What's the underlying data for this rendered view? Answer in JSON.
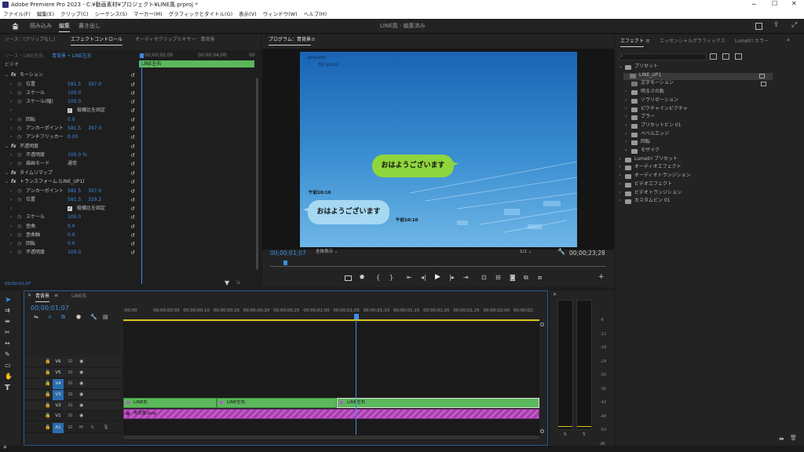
{
  "window": {
    "title": "Adobe Premiere Pro 2023 - C:¥動画素材¥プロジェクト¥LINE風.prproj *"
  },
  "menu": [
    "ファイル(F)",
    "編集(E)",
    "クリップ(C)",
    "シーケンス(S)",
    "マーカー(M)",
    "グラフィックとタイトル(G)",
    "表示(V)",
    "ウィンドウ(W)",
    "ヘルプ(H)"
  ],
  "workspace": {
    "tabs": [
      "読み込み",
      "編集",
      "書き出し"
    ],
    "active": "編集",
    "center": "LINE風 - 編集済み"
  },
  "effect_controls": {
    "tabs": [
      "ソース：(クリップなし)",
      "エフェクトコントロール",
      "オーディオクリップミキサー：青背景"
    ],
    "header_left": "ソース・LINE左右",
    "header_right": "青背景 • LINE左右",
    "ruler": [
      "00;00;02;00",
      "00;00;04;00",
      "00"
    ],
    "clip_label": "LINE左右",
    "video_label": "ビデオ",
    "rows": [
      {
        "name": "モーション",
        "value": "",
        "value2": ""
      },
      {
        "name": "位置",
        "value": "581.5",
        "value2": "397.0"
      },
      {
        "name": "スケール",
        "value": "100.0",
        "value2": ""
      },
      {
        "name": "スケール(幅)",
        "value": "100.0",
        "value2": ""
      },
      {
        "name": "縦横比を固定",
        "value": "",
        "value2": ""
      },
      {
        "name": "回転",
        "value": "0.0",
        "value2": ""
      },
      {
        "name": "アンカーポイント",
        "value": "581.5",
        "value2": "397.0"
      },
      {
        "name": "アンチフリッカー",
        "value": "0.00",
        "value2": ""
      },
      {
        "name": "不透明度",
        "value": "",
        "value2": ""
      },
      {
        "name": "不透明度",
        "value": "100.0 %",
        "value2": ""
      },
      {
        "name": "描画モード",
        "value": "通常",
        "value2": ""
      },
      {
        "name": "タイムリマップ",
        "value": "",
        "value2": ""
      },
      {
        "name": "トランスフォーム (LINE_UP1)",
        "value": "",
        "value2": ""
      },
      {
        "name": "アンカーポイント",
        "value": "581.5",
        "value2": "397.0"
      },
      {
        "name": "位置",
        "value": "581.5",
        "value2": "329.2"
      },
      {
        "name": "縦横比を固定",
        "value": "",
        "value2": ""
      },
      {
        "name": "スケール",
        "value": "100.0",
        "value2": ""
      },
      {
        "name": "歪曲",
        "value": "0.0",
        "value2": ""
      },
      {
        "name": "歪曲軸",
        "value": "0.0",
        "value2": ""
      },
      {
        "name": "回転",
        "value": "0.0",
        "value2": ""
      },
      {
        "name": "不透明度",
        "value": "100.0",
        "value2": ""
      }
    ],
    "timecode": "00;00;01;07"
  },
  "program": {
    "tab": "プログラム：青背景",
    "present": "present",
    "by": "by josuo",
    "bubble1": "おはようございます",
    "time1": "午前10:10",
    "bubble2": "おはようございます",
    "time2": "午前10:10",
    "timecode": "00;00;01;07",
    "fit": "全体表示",
    "quality": "1/2",
    "duration": "00;00;23;28",
    "colors": {
      "bubble1": "#8fd63c",
      "bubble2": "#a6d8f2"
    }
  },
  "effects": {
    "tabs": [
      "エフェクト",
      "エッセンシャルグラフィックス",
      "Lumetri カラー"
    ],
    "search_placeholder": "",
    "items": [
      {
        "label": "プリセット",
        "depth": 0,
        "open": true
      },
      {
        "label": "LINE_UP1",
        "depth": 1,
        "open": false
      },
      {
        "label": "文字モーション",
        "depth": 1,
        "open": false
      },
      {
        "label": "明るさの軌",
        "depth": 1,
        "open": false
      },
      {
        "label": "ソラリゼーション",
        "depth": 1,
        "open": false
      },
      {
        "label": "ピクチャインピクチャ",
        "depth": 1,
        "open": false
      },
      {
        "label": "ブラー",
        "depth": 1,
        "open": false
      },
      {
        "label": "プリセットビン 01",
        "depth": 1,
        "open": false
      },
      {
        "label": "ベベルエッジ",
        "depth": 1,
        "open": false
      },
      {
        "label": "回転",
        "depth": 1,
        "open": false
      },
      {
        "label": "モザイク",
        "depth": 1,
        "open": false
      },
      {
        "label": "Lumetri プリセット",
        "depth": 0,
        "open": false
      },
      {
        "label": "オーディオエフェクト",
        "depth": 0,
        "open": false
      },
      {
        "label": "オーディオトランジション",
        "depth": 0,
        "open": false
      },
      {
        "label": "ビデオエフェクト",
        "depth": 0,
        "open": false
      },
      {
        "label": "ビデオトランジション",
        "depth": 0,
        "open": false
      },
      {
        "label": "カスタムビン 01",
        "depth": 0,
        "open": false
      }
    ]
  },
  "timeline": {
    "tabs": [
      "青背景",
      "LINE右"
    ],
    "timecode": "00;00;01;07",
    "ruler": [
      ":00;00",
      "00;00;00;05",
      "00;00;00;10",
      "00;00;00;15",
      "00;00;00;20",
      "00;00;00;25",
      "00;00;01;00",
      "00;00;01;05",
      "00;00;01;10",
      "00;00;01;15",
      "00;00;01;20",
      "00;00;01;25",
      "00;00;02;00",
      "00;00;02;"
    ],
    "tracks": [
      "V6",
      "V5",
      "V4",
      "V3",
      "V2",
      "V1",
      "A1"
    ],
    "clips_v2": [
      "LINE右",
      "LINE左右",
      "LINE左右"
    ],
    "clip_v1": "青背景.png",
    "audio_buttons": [
      "M",
      "S"
    ]
  },
  "meter": {
    "scale": [
      "-6",
      "-12",
      "-18",
      "-24",
      "-30",
      "-36",
      "-42",
      "-48",
      "-54",
      "dB"
    ],
    "ch": [
      "S",
      "S"
    ]
  }
}
